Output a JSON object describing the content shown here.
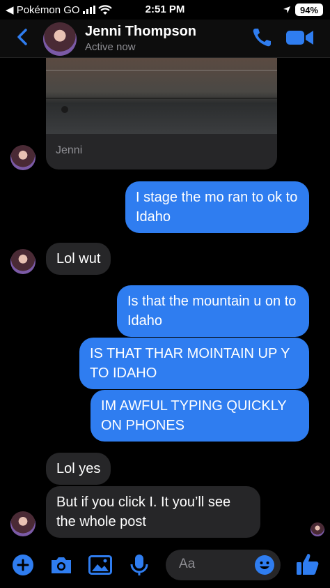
{
  "status_bar": {
    "back_app": "◀ Pokémon GO",
    "time": "2:51 PM",
    "battery": "94%"
  },
  "header": {
    "contact_name": "Jenni Thompson",
    "contact_status": "Active now"
  },
  "shared_post": {
    "caption": "Jenni"
  },
  "messages": [
    {
      "from": "me",
      "text": "I stage the mo ran to ok to Idaho"
    },
    {
      "from": "them",
      "text": "Lol wut"
    },
    {
      "from": "me",
      "text": "Is that the mountain u on to Idaho"
    },
    {
      "from": "me",
      "text": "IS THAT THAR MOINTAIN UP Y TO IDAHO"
    },
    {
      "from": "me",
      "text": "IM AWFUL TYPING QUICKLY ON PHONES"
    },
    {
      "from": "them",
      "text": "Lol yes"
    },
    {
      "from": "them",
      "text": "But if you click I. It you’ll see the whole post"
    }
  ],
  "composer": {
    "placeholder": "Aa",
    "icons": [
      "plus-icon",
      "camera-icon",
      "photo-icon",
      "microphone-icon",
      "emoji-icon",
      "thumbs-up-icon"
    ]
  },
  "colors": {
    "accent": "#2f7df0",
    "incoming_bubble": "#262628",
    "background": "#000000"
  }
}
